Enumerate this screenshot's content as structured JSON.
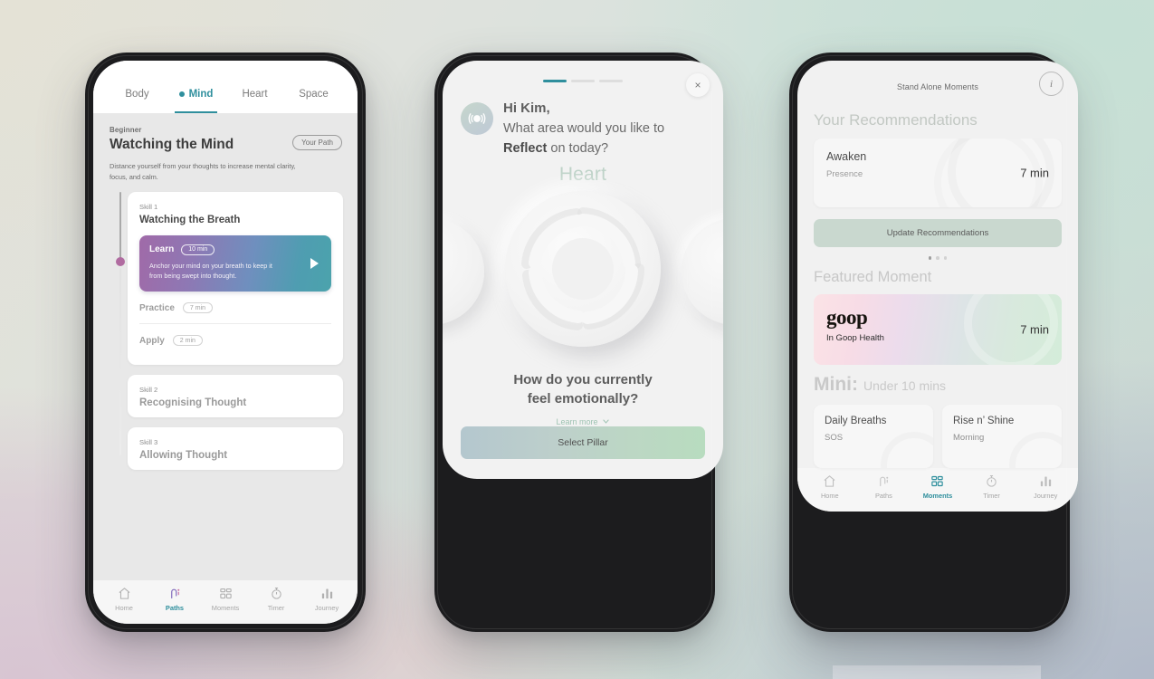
{
  "phone1": {
    "tabs": [
      {
        "label": "Body",
        "active": false
      },
      {
        "label": "Mind",
        "active": true
      },
      {
        "label": "Heart",
        "active": false
      },
      {
        "label": "Space",
        "active": false
      }
    ],
    "level": "Beginner",
    "title": "Watching the  Mind",
    "path_button": "Your Path",
    "description": "Distance yourself from your thoughts to increase mental clarity, focus, and calm.",
    "skills": [
      {
        "number": "Skill 1",
        "name": "Watching the Breath",
        "learn": {
          "label": "Learn",
          "duration": "10 min",
          "description": "Anchor your mind on your breath to keep it from being swept into thought."
        },
        "steps": [
          {
            "label": "Practice",
            "duration": "7 min"
          },
          {
            "label": "Apply",
            "duration": "2 min"
          }
        ]
      },
      {
        "number": "Skill 2",
        "name": "Recognising Thought"
      },
      {
        "number": "Skill 3",
        "name": "Allowing Thought"
      }
    ],
    "nav": [
      {
        "label": "Home",
        "icon": "home-icon",
        "active": false
      },
      {
        "label": "Paths",
        "icon": "paths-icon",
        "active": true
      },
      {
        "label": "Moments",
        "icon": "moments-icon",
        "active": false
      },
      {
        "label": "Timer",
        "icon": "timer-icon",
        "active": false
      },
      {
        "label": "Journey",
        "icon": "journey-icon",
        "active": false
      }
    ]
  },
  "phone2": {
    "progress": [
      true,
      false,
      false
    ],
    "close_label": "×",
    "greeting": "Hi Kim,",
    "question_pre": "What area would you like to ",
    "question_bold": "Reflect",
    "question_post": " on today?",
    "pillar": "Heart",
    "feel_line1": "How do you currently",
    "feel_line2": "feel emotionally?",
    "learn_more": "Learn more",
    "cta": "Select Pillar"
  },
  "phone3": {
    "header": "Stand Alone Moments",
    "info_label": "i",
    "section_recommendations": "Your Recommendations",
    "recommendation": {
      "title": "Awaken",
      "subtitle": "Presence",
      "duration": "7 min"
    },
    "update_button": "Update Recommendations",
    "carousel_dots": [
      true,
      false,
      false
    ],
    "section_featured": "Featured Moment",
    "featured": {
      "logo": "goop",
      "subtitle": "In Goop Health",
      "duration": "7 min"
    },
    "mini_heading_bold": "Mini:",
    "mini_heading_rest": "Under 10 mins",
    "mini_cards": [
      {
        "title": "Daily Breaths",
        "subtitle": "SOS"
      },
      {
        "title": "Rise n’ Shine",
        "subtitle": "Morning"
      }
    ],
    "nav": [
      {
        "label": "Home",
        "icon": "home-icon",
        "active": false
      },
      {
        "label": "Paths",
        "icon": "paths-icon",
        "active": false
      },
      {
        "label": "Moments",
        "icon": "moments-icon",
        "active": true
      },
      {
        "label": "Timer",
        "icon": "timer-icon",
        "active": false
      },
      {
        "label": "Journey",
        "icon": "journey-icon",
        "active": false
      }
    ]
  },
  "colors": {
    "accent_teal": "#2f8f9d",
    "sage": "#c9d8cf",
    "mauve_dot": "#b06ba0",
    "bg_mint": "#c6e0d5",
    "bg_lilac": "#d8c4d2",
    "bg_blue": "#b0b8c8",
    "bg_beige": "#e4e2d6"
  }
}
